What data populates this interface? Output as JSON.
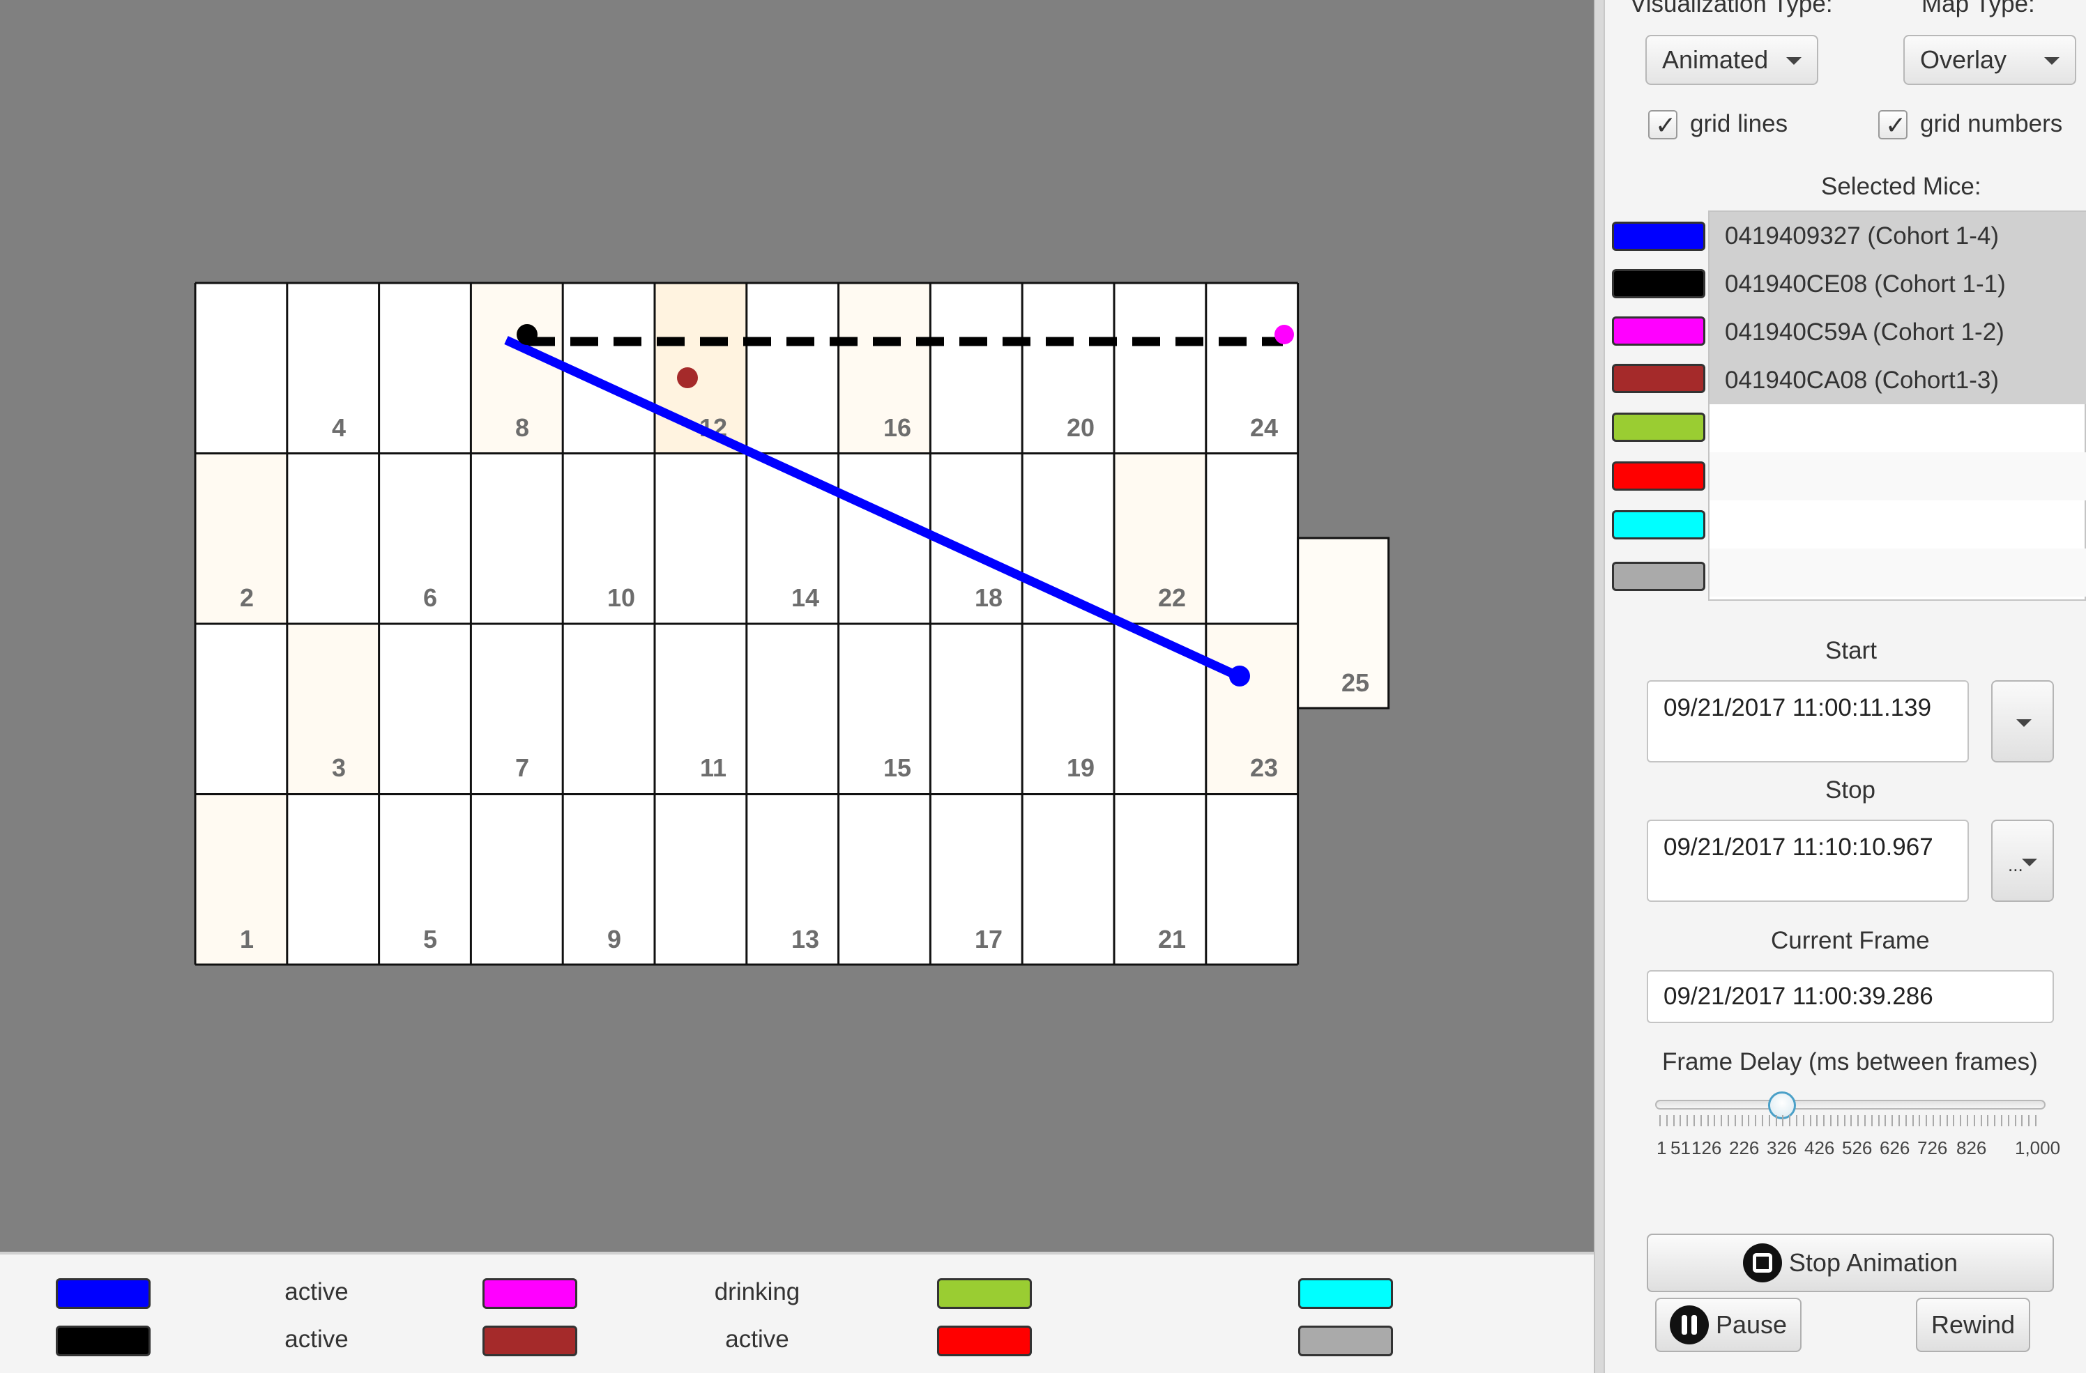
{
  "map": {
    "cell_numbers": [
      "1",
      "2",
      "3",
      "4",
      "5",
      "6",
      "7",
      "8",
      "9",
      "10",
      "11",
      "12",
      "13",
      "14",
      "15",
      "16",
      "17",
      "18",
      "19",
      "20",
      "21",
      "22",
      "23",
      "24",
      "25"
    ]
  },
  "legend": {
    "items": [
      {
        "color": "#0000ff",
        "label": "active"
      },
      {
        "color": "#000000",
        "label": "active"
      },
      {
        "color": "#ff00ff",
        "label": "drinking"
      },
      {
        "color": "#a52a2a",
        "label": "active"
      },
      {
        "color": "#9acd32",
        "label": ""
      },
      {
        "color": "#ff0000",
        "label": ""
      },
      {
        "color": "#00ffff",
        "label": ""
      },
      {
        "color": "#aaaaaa",
        "label": ""
      }
    ]
  },
  "panel": {
    "visualization_type_label": "Visualization Type:",
    "visualization_type_value": "Animated",
    "map_type_label": "Map Type:",
    "map_type_value": "Overlay",
    "grid_lines_label": "grid lines",
    "grid_lines_checked": true,
    "grid_numbers_label": "grid numbers",
    "grid_numbers_checked": true,
    "selected_mice_label": "Selected Mice:",
    "mice": [
      {
        "color": "#0000ff",
        "name": "0419409327 (Cohort 1-4)"
      },
      {
        "color": "#000000",
        "name": "041940CE08 (Cohort 1-1)"
      },
      {
        "color": "#ff00ff",
        "name": "041940C59A (Cohort 1-2)"
      },
      {
        "color": "#a52a2a",
        "name": "041940CA08 (Cohort1-3)"
      },
      {
        "color": "#9acd32",
        "name": ""
      },
      {
        "color": "#ff0000",
        "name": ""
      },
      {
        "color": "#00ffff",
        "name": ""
      },
      {
        "color": "#aaaaaa",
        "name": ""
      }
    ],
    "start_label": "Start",
    "start_value": "09/21/2017 11:00:11.139",
    "stop_label": "Stop",
    "stop_value": "09/21/2017 11:10:10.967",
    "stop_button_text": "...",
    "current_frame_label": "Current Frame",
    "current_frame_value": "09/21/2017 11:00:39.286",
    "frame_delay_label": "Frame Delay (ms between frames)",
    "frame_delay_value": 326,
    "frame_delay_min": 1,
    "frame_delay_max": 1000,
    "slider_tick_labels": [
      "1",
      "51",
      "126",
      "226",
      "326",
      "426",
      "526",
      "626",
      "726",
      "826",
      "1,000"
    ],
    "stop_animation_label": "Stop Animation",
    "pause_label": "Pause",
    "rewind_label": "Rewind"
  }
}
